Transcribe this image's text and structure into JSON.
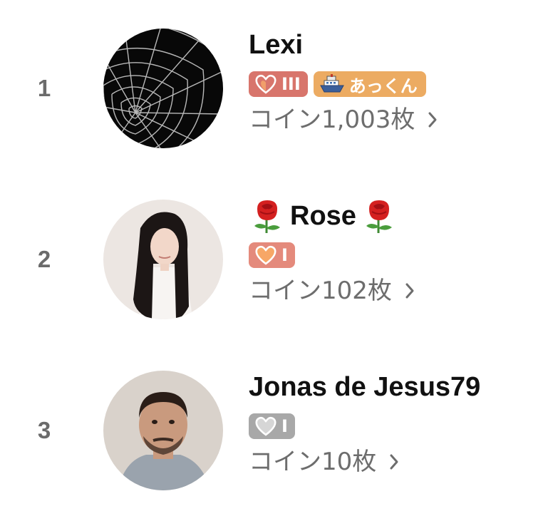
{
  "ranking": [
    {
      "rank": "1",
      "name": "Lexi",
      "level_badge": {
        "icon": "heart-icon",
        "label": "III",
        "color": "#d8756c"
      },
      "extra_badge": {
        "icon": "ship-icon",
        "label": "あっくん",
        "color": "#ecab62"
      },
      "coins": "コイン1,003枚"
    },
    {
      "rank": "2",
      "name": "Rose",
      "name_decoration": "rose-icon",
      "level_badge": {
        "icon": "heart-icon",
        "label": "I",
        "color": "#e48a7c"
      },
      "coins": "コイン102枚"
    },
    {
      "rank": "3",
      "name": "Jonas de Jesus79",
      "level_badge": {
        "icon": "heart-icon",
        "label": "I",
        "color": "#a8a8a8"
      },
      "coins": "コイン10枚"
    }
  ],
  "colors": {
    "rank_text": "#6b6b6b",
    "coin_text": "#6d6d6d",
    "name_text": "#111111"
  }
}
